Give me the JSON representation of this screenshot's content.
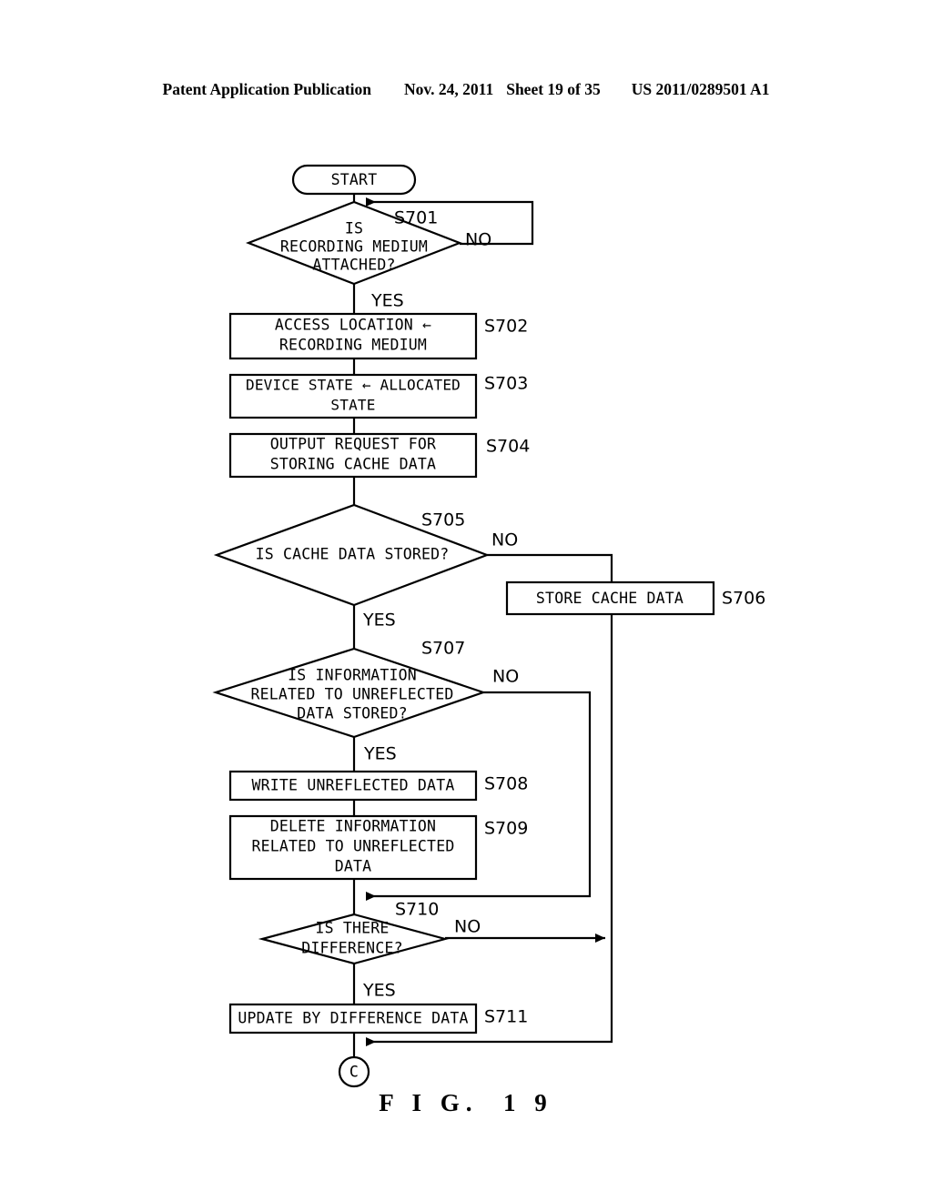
{
  "header": {
    "publication": "Patent Application Publication",
    "date": "Nov. 24, 2011",
    "sheet": "Sheet 19 of 35",
    "patent_number": "US 2011/0289501 A1"
  },
  "figure": {
    "caption": "F I G.  1 9"
  },
  "flowchart": {
    "start_label": "START",
    "end_connector_label": "C",
    "branch_yes": "YES",
    "branch_no": "NO",
    "nodes": [
      {
        "id": "start",
        "type": "terminator",
        "text": "START"
      },
      {
        "id": "S701",
        "type": "decision",
        "step": "S701",
        "lines": [
          "IS",
          "RECORDING MEDIUM",
          "ATTACHED?"
        ],
        "yes": "YES",
        "no": "NO"
      },
      {
        "id": "S702",
        "type": "process",
        "step": "S702",
        "lines": [
          "ACCESS LOCATION ←",
          "RECORDING MEDIUM"
        ]
      },
      {
        "id": "S703",
        "type": "process",
        "step": "S703",
        "lines": [
          "DEVICE STATE ← ALLOCATED",
          "STATE"
        ]
      },
      {
        "id": "S704",
        "type": "process",
        "step": "S704",
        "lines": [
          "OUTPUT REQUEST FOR",
          "STORING CACHE DATA"
        ]
      },
      {
        "id": "S705",
        "type": "decision",
        "step": "S705",
        "lines": [
          "IS CACHE DATA STORED?"
        ],
        "yes": "YES",
        "no": "NO"
      },
      {
        "id": "S706",
        "type": "process",
        "step": "S706",
        "lines": [
          "STORE CACHE DATA"
        ]
      },
      {
        "id": "S707",
        "type": "decision",
        "step": "S707",
        "lines": [
          "IS INFORMATION",
          "RELATED TO UNREFLECTED",
          "DATA STORED?"
        ],
        "yes": "YES",
        "no": "NO"
      },
      {
        "id": "S708",
        "type": "process",
        "step": "S708",
        "lines": [
          "WRITE UNREFLECTED DATA"
        ]
      },
      {
        "id": "S709",
        "type": "process",
        "step": "S709",
        "lines": [
          "DELETE INFORMATION",
          "RELATED TO UNREFLECTED",
          "DATA"
        ]
      },
      {
        "id": "S710",
        "type": "decision",
        "step": "S710",
        "lines": [
          "IS THERE",
          "DIFFERENCE?"
        ],
        "yes": "YES",
        "no": "NO"
      },
      {
        "id": "S711",
        "type": "process",
        "step": "S711",
        "lines": [
          "UPDATE BY DIFFERENCE DATA"
        ]
      },
      {
        "id": "C",
        "type": "connector",
        "text": "C"
      }
    ]
  }
}
